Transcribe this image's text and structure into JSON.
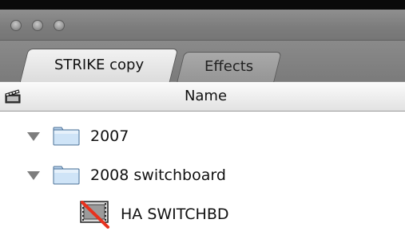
{
  "window": {
    "traffic_lights": [
      "close",
      "minimize",
      "zoom"
    ]
  },
  "tabs": [
    {
      "label": "STRIKE copy",
      "active": true
    },
    {
      "label": "Effects",
      "active": false
    }
  ],
  "columns": {
    "header_icon": "clapperboard-icon",
    "name": "Name"
  },
  "items": [
    {
      "label": "2007",
      "type": "bin",
      "expanded": true,
      "icon": "folder-icon"
    },
    {
      "label": "2008 switchboard",
      "type": "bin",
      "expanded": true,
      "icon": "folder-icon"
    },
    {
      "label": "HA SWITCHBD",
      "type": "clip",
      "icon": "clip-offline-icon"
    }
  ],
  "colors": {
    "titlebar": "#7c7c7c",
    "folder_fill": "#c9e0f5",
    "offline_slash": "#e8321e"
  }
}
